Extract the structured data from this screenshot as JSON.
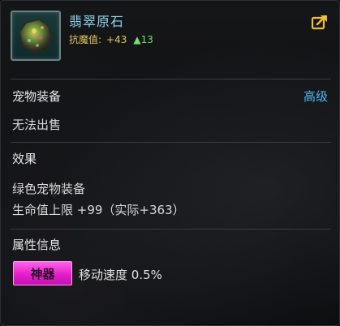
{
  "item": {
    "name": "翡翠原石",
    "stat_label": "抗魔值:",
    "stat_value": "+43",
    "stat_upgrade": "▲13",
    "icon": "jade-gem-icon",
    "share_icon": "share-external-icon"
  },
  "equipment": {
    "section": "宠物装备",
    "grade": "高级",
    "sell_status": "无法出售"
  },
  "effect": {
    "section": "效果",
    "type": "绿色宠物装备",
    "detail": "生命值上限 +99（实际+363）"
  },
  "attributes": {
    "section": "属性信息",
    "badge": "神器",
    "text": "移动速度 0.5%"
  },
  "colors": {
    "name": "#8fd5ee",
    "stat": "#e6c55a",
    "upgrade": "#79e06a",
    "grade": "#4fb6ee",
    "badge": "#e41fcb"
  }
}
